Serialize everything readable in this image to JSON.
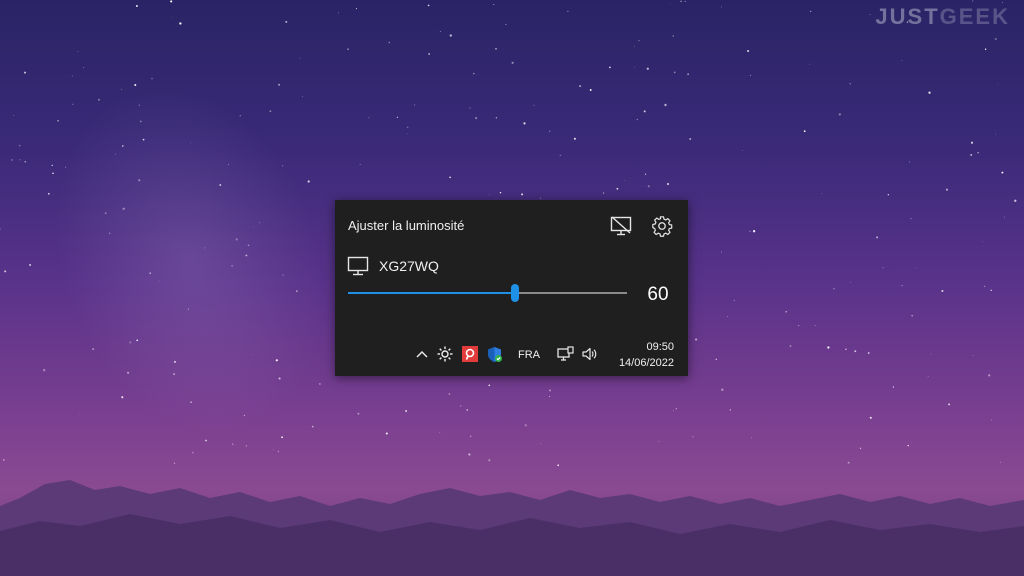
{
  "watermark": {
    "part1": "JUST",
    "part2": "GEEK"
  },
  "flyout": {
    "title": "Ajuster la luminosité",
    "display_off_icon": "monitor-off-icon",
    "settings_icon": "gear-icon",
    "monitor": {
      "icon": "monitor-icon",
      "name": "XG27WQ"
    },
    "brightness": {
      "value": "60",
      "level": 0.6,
      "accent": "#1e90e6"
    }
  },
  "taskbar": {
    "icons": [
      "chevron-up-icon",
      "brightness-icon",
      "app-red-icon",
      "defender-shield-icon",
      "network-icon",
      "volume-icon"
    ],
    "language": "FRA",
    "time": "09:50",
    "date": "14/06/2022"
  }
}
